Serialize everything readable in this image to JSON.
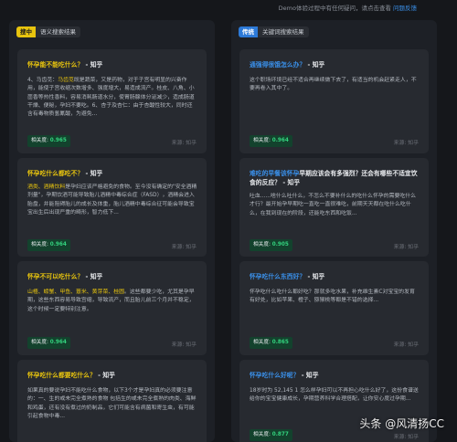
{
  "topbar": {
    "text": "Demo体验过程中有任何疑问，请点击查看",
    "link": "问题反馈"
  },
  "left": {
    "tag": [
      "搜中",
      "语义搜索结果"
    ],
    "cards": [
      {
        "q": "怀孕能不能吃什么？",
        "suffix": " - 知乎",
        "body_hl": "4、马齿苋：",
        "body_hl2": "马齿苋",
        "body": "既是蔬菜，又是药物，对于子宫有明显的兴奋作用，能使子宫收缩次数增多、强度增大，易造成流产。桂皮、八角、小茴香等热性香料，容易消耗肠道水分，使胃肠腺体分泌减少，造成肠道干燥、便秘，孕妇不要吃。6、杏子及杏仁：由于杏酸性较大，同时还含有毒物质氢氰酸，为避免...",
        "score_label": "相关度:",
        "score": "0.965",
        "source": "来源: 知乎"
      },
      {
        "q": "怀孕吃什么都吃不？",
        "suffix": " - 知乎",
        "body_hl": "酒类、酒精饮料",
        "body": "是孕妇应该严格避免的食物。至今没有确定的\"安全酒精剂量\"，孕期饮酒可能导致胎儿酒精中毒综合症（FASD），酒精会进入胎盘，并能阻碍胎儿的成长及体重，胎儿酒精中毒综合征可能会导致宝宝出生后出现严重的畸形，智力低下...",
        "score_label": "相关度:",
        "score": "0.964",
        "source": "来源: 知乎"
      },
      {
        "q": "怀孕不可以吃什么？",
        "suffix": " - 知乎",
        "body_hl": "山楂、螃蟹、甲鱼、薏米、黄芽菜、桂圆",
        "body_hl_tail": "。这些都要少吃，尤其是孕早期，这些东西容易导致宫缩，导致流产，而且胎儿前三个月并不稳定，这个时候一定要特别注意。",
        "body": "",
        "score_label": "相关度:",
        "score": "0.964",
        "source": "来源: 知乎"
      },
      {
        "q": "怀孕吃什么都要吃什么？",
        "suffix": " - 知乎",
        "body_hl": "",
        "body": "如果真的要说孕妇不能吃什么食物，以下3个才是孕妇真的必须要注意的：一、生的或未完全煮熟的食物 包括生的或未完全煮熟的肉类、海鲜和鸡蛋，还有没有煮过的奶制品，它们可能含有病菌和寄生虫，有可能引起食物中毒...",
        "score_label": "相关度:",
        "score": "0.964",
        "source": "来源: 知乎"
      }
    ]
  },
  "right": {
    "tag": [
      "传统",
      "关键词搜索结果"
    ],
    "cards": [
      {
        "q": "通强得很饿怎么办？",
        "suffix": " - 知乎",
        "body": "这个职场环境已经不适合再继续做下去了，有适当的机会赶紧走人，不要再卷入其中了。",
        "score_label": "相关度:",
        "score": "0.964",
        "source": "来源: 知乎"
      },
      {
        "q": "难吃的早餐该怀孕",
        "q_tail": "早期应该会有多强烈？还会有哪些不适宜饮食的反应？",
        "suffix": " - 知乎",
        "body": "吐血......啥什么吐什么，不怎么不要补什么的吃什么怀孕的需要吃什么才行？最开始孕早期吃一直吃一直很难吃，前期天天都在吃什么吃什么，在我到现在的阶段，还能吃东西和吃饭...",
        "score_label": "相关度:",
        "score": "0.905",
        "source": "来源: 知乎"
      },
      {
        "q": "怀孕吃什么东西好？",
        "suffix": " - 知乎",
        "body": "怀孕吃什么吃什么都好吃？那就多吃水果，补充维生素C对宝宝的发育有好处，比如苹果、橙子、猕猴桃等都是不错的选择...",
        "score_label": "相关度:",
        "score": "0.865",
        "source": "来源: 知乎"
      },
      {
        "q": "怀孕吃什么好呢？",
        "suffix": " - 知乎",
        "body": "18岁时为 52,145 1 怎么样孕妇可以不再担心吃什么好了，这份食谱送给你的宝宝健康成长，孕期营养科学合理搭配，让你安心度过孕期...",
        "score_label": "相关度:",
        "score": "0.877",
        "source": "来源: 知乎"
      }
    ]
  },
  "watermark": "头条 @风清扬CC"
}
